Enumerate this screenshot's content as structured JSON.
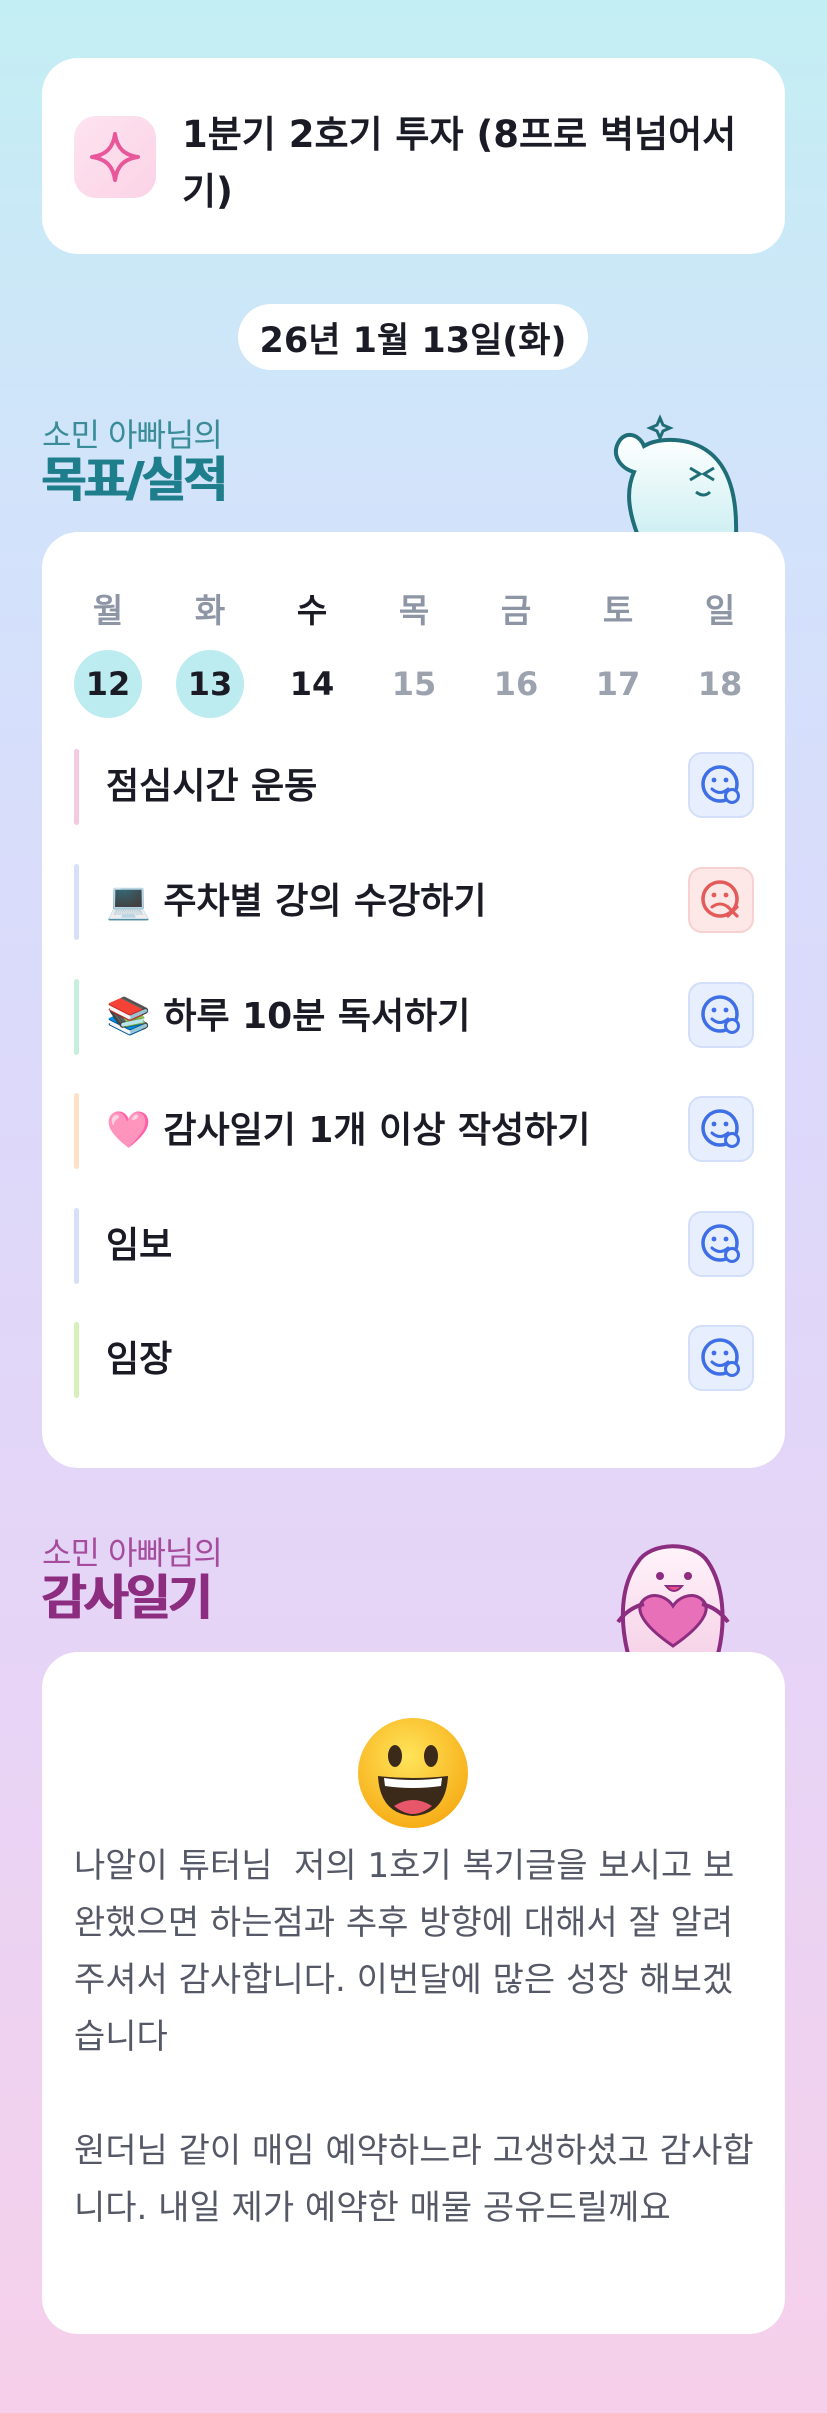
{
  "goal": {
    "text": "1분기 2호기 투자 (8프로 벽넘어서기)"
  },
  "date": {
    "label": "26년 1월 13일(화)"
  },
  "goals_section": {
    "owner": "소민 아빠님의",
    "title": "목표/실적"
  },
  "week": [
    {
      "dow": "월",
      "num": "12",
      "state": "done"
    },
    {
      "dow": "화",
      "num": "13",
      "state": "done"
    },
    {
      "dow": "수",
      "num": "14",
      "state": "today"
    },
    {
      "dow": "목",
      "num": "15",
      "state": "future"
    },
    {
      "dow": "금",
      "num": "16",
      "state": "future"
    },
    {
      "dow": "토",
      "num": "17",
      "state": "future"
    },
    {
      "dow": "일",
      "num": "18",
      "state": "future"
    }
  ],
  "tasks": [
    {
      "label": "점심시간 운동",
      "bar_color": "#f7c8e1",
      "status": "done"
    },
    {
      "label": "💻 주차별 강의 수강하기",
      "bar_color": "#d6e0f7",
      "status": "failed"
    },
    {
      "label": "📚 하루 10분 독서하기",
      "bar_color": "#c6efdc",
      "status": "done"
    },
    {
      "label": "🩷 감사일기 1개 이상 작성하기",
      "bar_color": "#fde1c6",
      "status": "done"
    },
    {
      "label": "임보",
      "bar_color": "#d6e0f7",
      "status": "done"
    },
    {
      "label": "임장",
      "bar_color": "#d5f0b8",
      "status": "done"
    }
  ],
  "gratitude_section": {
    "owner": "소민 아빠님의",
    "title": "감사일기"
  },
  "gratitude": {
    "emoji": "grinning-face-icon",
    "text": "나알이 튜터님  저의 1호기 복기글을 보시고 보완했으면 하는점과 추후 방향에 대해서 잘 알려주셔서 감사합니다. 이번달에 많은 성장 해보겠습니다\n\n원더님 같이 매임 예약하느라 고생하셨고 감사합니다. 내일 제가 예약한 매물 공유드릴께요"
  },
  "colors": {
    "accent_teal": "#1f7e8b",
    "accent_pink": "#8c2d80",
    "done_circle": "#bcecf0"
  }
}
